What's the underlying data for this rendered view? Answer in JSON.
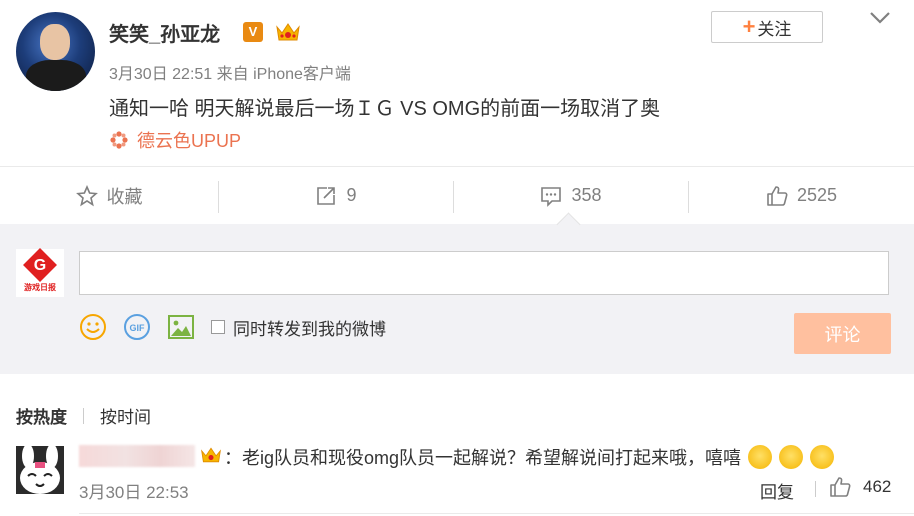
{
  "post": {
    "username": "笑笑_孙亚龙",
    "verified_badge": "V",
    "follow_label": "关注",
    "follow_plus": "+",
    "timestamp": "3月30日 22:51",
    "source": "来自 iPhone客户端",
    "text": "通知一哈 明天解说最后一场ＩＧ VS OMG的前面一场取消了奥",
    "topic": "德云色UPUP"
  },
  "actions": {
    "favorite_label": "收藏",
    "repost_count": "9",
    "comment_count": "358",
    "like_count": "2525"
  },
  "compose": {
    "logo_letter": "G",
    "logo_text": "游戏日报",
    "input_value": "",
    "repost_checkbox_label": "同时转发到我的微博",
    "submit_label": "评论"
  },
  "sort": {
    "by_hot": "按热度",
    "by_time": "按时间"
  },
  "comments": [
    {
      "text": "：老ig队员和现役omg队员一起解说？希望解说间打起来哦，嘻嘻",
      "time": "3月30日 22:53",
      "reply_label": "回复",
      "likes": "462"
    }
  ],
  "colors": {
    "accent_orange": "#ff8140",
    "topic_orange": "#eb7350",
    "submit_disabled": "#ffc09f"
  }
}
